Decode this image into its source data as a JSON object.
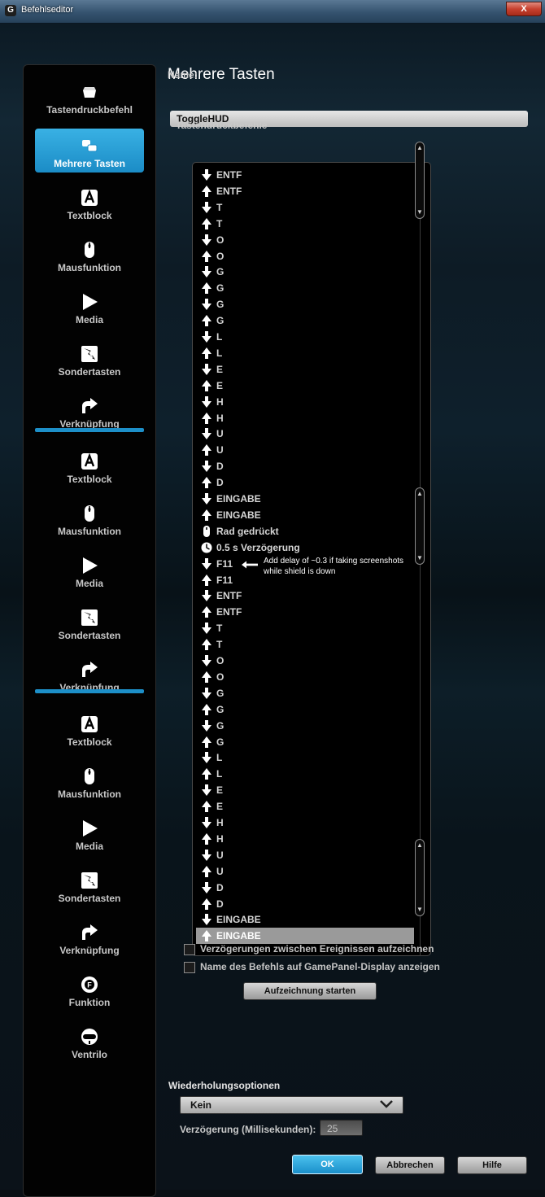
{
  "window": {
    "title": "Befehlseditor",
    "close_label": "X"
  },
  "sidebar": {
    "items": [
      {
        "label": "Tastendruckbefehl",
        "icon": "keystroke-icon"
      },
      {
        "label": "Mehrere Tasten",
        "icon": "multi-keys-icon",
        "active": true
      },
      {
        "label": "Textblock",
        "icon": "textblock-icon"
      },
      {
        "label": "Mausfunktion",
        "icon": "mouse-icon"
      },
      {
        "label": "Media",
        "icon": "media-play-icon"
      },
      {
        "label": "Sondertasten",
        "icon": "hotkey-icon"
      },
      {
        "label": "Verknüpfung",
        "icon": "shortcut-icon"
      },
      {
        "label": "Textblock",
        "icon": "textblock-icon"
      },
      {
        "label": "Mausfunktion",
        "icon": "mouse-icon"
      },
      {
        "label": "Media",
        "icon": "media-play-icon"
      },
      {
        "label": "Sondertasten",
        "icon": "hotkey-icon"
      },
      {
        "label": "Verknüpfung",
        "icon": "shortcut-icon"
      },
      {
        "label": "Textblock",
        "icon": "textblock-icon"
      },
      {
        "label": "Mausfunktion",
        "icon": "mouse-icon"
      },
      {
        "label": "Media",
        "icon": "media-play-icon"
      },
      {
        "label": "Sondertasten",
        "icon": "hotkey-icon"
      },
      {
        "label": "Verknüpfung",
        "icon": "shortcut-icon"
      },
      {
        "label": "Funktion",
        "icon": "function-icon"
      },
      {
        "label": "Ventrilo",
        "icon": "ventrilo-headset-icon"
      }
    ]
  },
  "main": {
    "heading": "Mehrere Tasten",
    "name_label": "Name:",
    "name_value": "ToggleHUD",
    "list_label": "Tastendruckbefehle",
    "events": [
      {
        "dir": "down",
        "text": "ENTF"
      },
      {
        "dir": "up",
        "text": "ENTF"
      },
      {
        "dir": "down",
        "text": "T"
      },
      {
        "dir": "up",
        "text": "T"
      },
      {
        "dir": "down",
        "text": "O"
      },
      {
        "dir": "up",
        "text": "O"
      },
      {
        "dir": "down",
        "text": "G"
      },
      {
        "dir": "up",
        "text": "G"
      },
      {
        "dir": "down",
        "text": "G"
      },
      {
        "dir": "up",
        "text": "G"
      },
      {
        "dir": "down",
        "text": "L"
      },
      {
        "dir": "up",
        "text": "L"
      },
      {
        "dir": "down",
        "text": "E"
      },
      {
        "dir": "up",
        "text": "E"
      },
      {
        "dir": "down",
        "text": "H"
      },
      {
        "dir": "up",
        "text": "H"
      },
      {
        "dir": "down",
        "text": "U"
      },
      {
        "dir": "up",
        "text": "U"
      },
      {
        "dir": "down",
        "text": "D"
      },
      {
        "dir": "up",
        "text": "D"
      },
      {
        "dir": "down",
        "text": "EINGABE"
      },
      {
        "dir": "up",
        "text": "EINGABE"
      },
      {
        "dir": "mouse",
        "text": "Rad gedrückt"
      },
      {
        "dir": "delay",
        "text": "0.5 s Verzögerung"
      },
      {
        "dir": "down",
        "text": "F11"
      },
      {
        "dir": "up",
        "text": "F11"
      },
      {
        "dir": "down",
        "text": "ENTF"
      },
      {
        "dir": "up",
        "text": "ENTF"
      },
      {
        "dir": "down",
        "text": "T"
      },
      {
        "dir": "up",
        "text": "T"
      },
      {
        "dir": "down",
        "text": "O"
      },
      {
        "dir": "up",
        "text": "O"
      },
      {
        "dir": "down",
        "text": "G"
      },
      {
        "dir": "up",
        "text": "G"
      },
      {
        "dir": "down",
        "text": "G"
      },
      {
        "dir": "up",
        "text": "G"
      },
      {
        "dir": "down",
        "text": "L"
      },
      {
        "dir": "up",
        "text": "L"
      },
      {
        "dir": "down",
        "text": "E"
      },
      {
        "dir": "up",
        "text": "E"
      },
      {
        "dir": "down",
        "text": "H"
      },
      {
        "dir": "up",
        "text": "H"
      },
      {
        "dir": "down",
        "text": "U"
      },
      {
        "dir": "up",
        "text": "U"
      },
      {
        "dir": "down",
        "text": "D"
      },
      {
        "dir": "up",
        "text": "D"
      },
      {
        "dir": "down",
        "text": "EINGABE"
      },
      {
        "dir": "up",
        "text": "EINGABE",
        "selected": true
      }
    ],
    "annotation": "Add delay of ~0.3 if taking screenshots while shield is down",
    "checkboxes": [
      {
        "label": "Verzögerungen zwischen Ereignissen aufzeichnen",
        "checked": false
      },
      {
        "label": "Name des Befehls auf GamePanel-Display anzeigen",
        "checked": false
      }
    ],
    "record_button": "Aufzeichnung starten",
    "repeat_label": "Wiederholungsoptionen",
    "repeat_value": "Kein",
    "delay_label": "Verzögerung (Millisekunden):",
    "delay_value": "25",
    "ok_label": "OK",
    "cancel_label": "Abbrechen",
    "help_label": "Hilfe"
  },
  "colors": {
    "accent": "#1d8fc8",
    "panel": "#020202",
    "selected_row": "#9a9a9a"
  }
}
